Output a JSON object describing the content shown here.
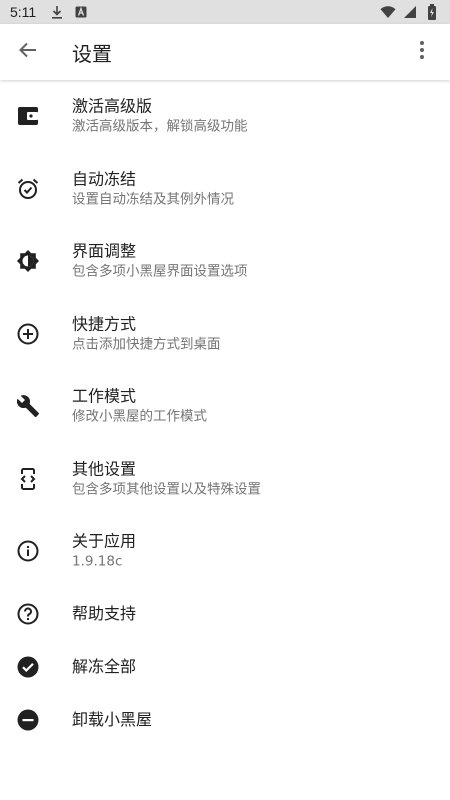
{
  "status_bar": {
    "time": "5:11",
    "left_icons": [
      "download-icon",
      "font-a-icon"
    ],
    "right_icons": [
      "wifi-icon",
      "signal-icon",
      "battery-icon"
    ]
  },
  "app_bar": {
    "title": "设置",
    "back_icon": "arrow-back-icon",
    "more_icon": "more-vert-icon"
  },
  "items": [
    {
      "icon": "wallet-icon",
      "title": "激活高级版",
      "subtitle": "激活高级版本，解锁高级功能"
    },
    {
      "icon": "alarm-check-icon",
      "title": "自动冻结",
      "subtitle": "设置自动冻结及其例外情况"
    },
    {
      "icon": "brightness-icon",
      "title": "界面调整",
      "subtitle": "包含多项小黑屋界面设置选项"
    },
    {
      "icon": "add-circle-icon",
      "title": "快捷方式",
      "subtitle": "点击添加快捷方式到桌面"
    },
    {
      "icon": "wrench-icon",
      "title": "工作模式",
      "subtitle": "修改小黑屋的工作模式"
    },
    {
      "icon": "developer-mode-icon",
      "title": "其他设置",
      "subtitle": "包含多项其他设置以及特殊设置"
    },
    {
      "icon": "info-icon",
      "title": "关于应用",
      "subtitle": "1.9.18c"
    },
    {
      "icon": "help-icon",
      "title": "帮助支持"
    },
    {
      "icon": "check-circle-icon",
      "title": "解冻全部"
    },
    {
      "icon": "remove-circle-icon",
      "title": "卸载小黑屋"
    }
  ],
  "colors": {
    "status_bar_bg": "#e0e0e0",
    "text_primary": "#212121",
    "text_secondary": "#757575",
    "icon": "#212121"
  }
}
